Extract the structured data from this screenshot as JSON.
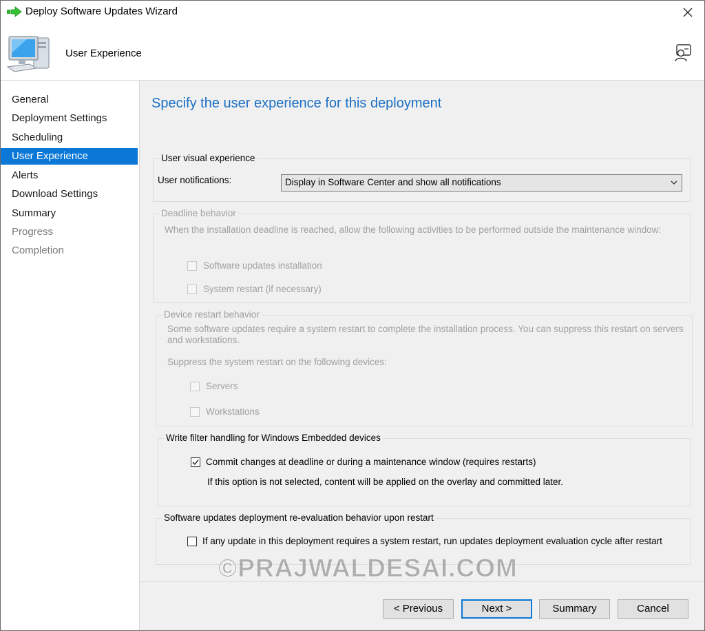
{
  "window": {
    "title": "Deploy Software Updates Wizard"
  },
  "header": {
    "title": "User Experience"
  },
  "sidebar": {
    "items": [
      {
        "label": "General",
        "state": "normal"
      },
      {
        "label": "Deployment Settings",
        "state": "normal"
      },
      {
        "label": "Scheduling",
        "state": "normal"
      },
      {
        "label": "User Experience",
        "state": "active"
      },
      {
        "label": "Alerts",
        "state": "normal"
      },
      {
        "label": "Download Settings",
        "state": "normal"
      },
      {
        "label": "Summary",
        "state": "normal"
      },
      {
        "label": "Progress",
        "state": "disabled"
      },
      {
        "label": "Completion",
        "state": "disabled"
      }
    ]
  },
  "main": {
    "heading": "Specify the user experience for this deployment",
    "visual": {
      "legend": "User visual experience",
      "notifications_label": "User notifications:",
      "notifications_value": "Display in Software Center and show all notifications"
    },
    "deadline": {
      "legend": "Deadline behavior",
      "description": "When the installation deadline is reached, allow the following activities to be performed outside the maintenance window:",
      "options": [
        "Software updates installation",
        "System restart (if necessary)"
      ]
    },
    "restart": {
      "legend": "Device restart behavior",
      "description_line1": "Some software updates require a system restart to complete the installation process. You can suppress this restart on servers",
      "description_line2": "and workstations.",
      "suppress_label": "Suppress the system restart on the following devices:",
      "options": [
        "Servers",
        "Workstations"
      ]
    },
    "write_filter": {
      "legend": "Write filter handling for Windows Embedded devices",
      "commit_label": "Commit changes at deadline or during a maintenance window (requires restarts)",
      "commit_checked": true,
      "note": "If this option is not selected, content will be applied on the overlay and committed later."
    },
    "reeval": {
      "legend": "Software updates deployment re-evaluation behavior upon restart",
      "label": "If any update in this deployment requires a system restart, run updates deployment evaluation cycle after restart",
      "checked": false
    }
  },
  "watermark": "©PRAJWALDESAI.COM",
  "buttons": {
    "previous": "< Previous",
    "next": "Next >",
    "summary": "Summary",
    "cancel": "Cancel"
  },
  "colors": {
    "accent": "#0b78d7",
    "heading": "#1a6fc4",
    "panel": "#f0f0f0"
  }
}
